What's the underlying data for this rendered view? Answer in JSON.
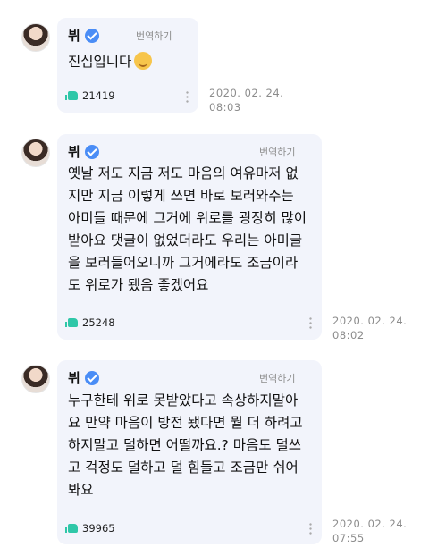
{
  "comments": [
    {
      "author": "뷔",
      "translate_label": "번역하기",
      "text": "진심입니다",
      "emoji": "hugging-face",
      "likes": "21419",
      "timestamp": "2020. 02. 24.\n08:03"
    },
    {
      "author": "뷔",
      "translate_label": "번역하기",
      "text": "옛날 저도 지금 저도 마음의 여유마저 없\n지만 지금 이렇게 쓰면 바로 보러와주는\n아미들 때문에 그거에 위로를 굉장히 많이\n받아요 댓글이 없었더라도 우리는 아미글\n을 보러들어오니까 그거에라도 조금이라\n도 위로가 됐음 좋겠어요",
      "likes": "25248",
      "timestamp": "2020. 02. 24.\n08:02"
    },
    {
      "author": "뷔",
      "translate_label": "번역하기",
      "text": "누구한테 위로 못받았다고 속상하지말아\n요 만약 마음이 방전 됐다면 뭘 더 하려고\n하지말고 덜하면 어떨까요.? 마음도 덜쓰\n고 걱정도 덜하고 덜 힘들고 조금만 쉬어\n봐요",
      "likes": "39965",
      "timestamp": "2020. 02. 24.\n07:55"
    }
  ]
}
